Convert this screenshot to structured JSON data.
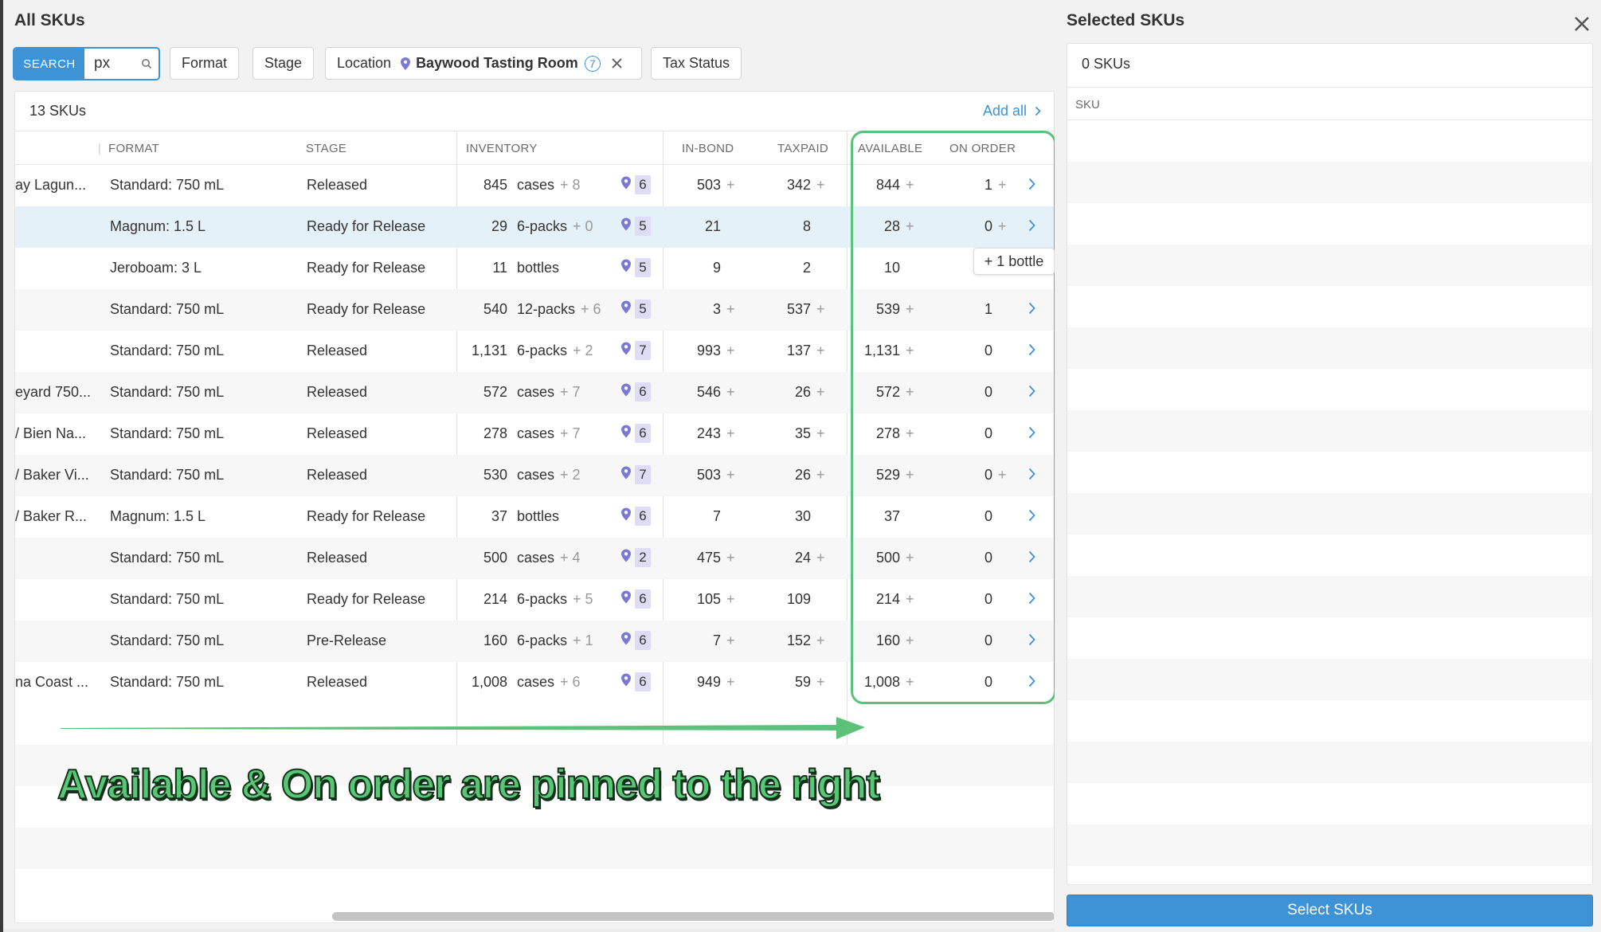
{
  "left_panel": {
    "title": "All SKUs",
    "search": {
      "tag": "SEARCH",
      "value": "px"
    },
    "filters": {
      "format": "Format",
      "stage": "Stage",
      "location_label": "Location",
      "location_value": "Baywood Tasting Room",
      "location_count": "7",
      "tax_status": "Tax Status"
    },
    "count_label": "13 SKUs",
    "add_all": "Add all",
    "columns": {
      "format": "FORMAT",
      "stage": "STAGE",
      "inventory": "INVENTORY",
      "in_bond": "IN-BOND",
      "taxpaid": "TAXPAID",
      "available": "AVAILABLE",
      "on_order": "ON ORDER"
    },
    "rows": [
      {
        "name": "ay Lagun...",
        "format": "Standard: 750 mL",
        "stage": "Released",
        "inv_qty": "845",
        "inv_unit": "cases",
        "inv_extra": "+ 8",
        "loc_count": "6",
        "in_bond": "503",
        "in_bond_plus": "+",
        "taxpaid": "342",
        "taxpaid_plus": "+",
        "available": "844",
        "available_plus": "+",
        "on_order": "1",
        "on_order_plus": "+"
      },
      {
        "name": "",
        "format": "Magnum: 1.5 L",
        "stage": "Ready for Release",
        "inv_qty": "29",
        "inv_unit": "6-packs",
        "inv_extra": "+ 0",
        "loc_count": "5",
        "in_bond": "21",
        "in_bond_plus": "",
        "taxpaid": "8",
        "taxpaid_plus": "",
        "available": "28",
        "available_plus": "+",
        "on_order": "0",
        "on_order_plus": "+"
      },
      {
        "name": "",
        "format": "Jeroboam: 3 L",
        "stage": "Ready for Release",
        "inv_qty": "11",
        "inv_unit": "bottles",
        "inv_extra": "",
        "loc_count": "5",
        "in_bond": "9",
        "in_bond_plus": "",
        "taxpaid": "2",
        "taxpaid_plus": "",
        "available": "10",
        "available_plus": "",
        "on_order": "",
        "on_order_plus": ""
      },
      {
        "name": "",
        "format": "Standard: 750 mL",
        "stage": "Ready for Release",
        "inv_qty": "540",
        "inv_unit": "12-packs",
        "inv_extra": "+ 6",
        "loc_count": "5",
        "in_bond": "3",
        "in_bond_plus": "+",
        "taxpaid": "537",
        "taxpaid_plus": "+",
        "available": "539",
        "available_plus": "+",
        "on_order": "1",
        "on_order_plus": ""
      },
      {
        "name": "",
        "format": "Standard: 750 mL",
        "stage": "Released",
        "inv_qty": "1,131",
        "inv_unit": "6-packs",
        "inv_extra": "+ 2",
        "loc_count": "7",
        "in_bond": "993",
        "in_bond_plus": "+",
        "taxpaid": "137",
        "taxpaid_plus": "+",
        "available": "1,131",
        "available_plus": "+",
        "on_order": "0",
        "on_order_plus": ""
      },
      {
        "name": "eyard 750...",
        "format": "Standard: 750 mL",
        "stage": "Released",
        "inv_qty": "572",
        "inv_unit": "cases",
        "inv_extra": "+ 7",
        "loc_count": "6",
        "in_bond": "546",
        "in_bond_plus": "+",
        "taxpaid": "26",
        "taxpaid_plus": "+",
        "available": "572",
        "available_plus": "+",
        "on_order": "0",
        "on_order_plus": ""
      },
      {
        "name": "/ Bien Na...",
        "format": "Standard: 750 mL",
        "stage": "Released",
        "inv_qty": "278",
        "inv_unit": "cases",
        "inv_extra": "+ 7",
        "loc_count": "6",
        "in_bond": "243",
        "in_bond_plus": "+",
        "taxpaid": "35",
        "taxpaid_plus": "+",
        "available": "278",
        "available_plus": "+",
        "on_order": "0",
        "on_order_plus": ""
      },
      {
        "name": "/ Baker Vi...",
        "format": "Standard: 750 mL",
        "stage": "Released",
        "inv_qty": "530",
        "inv_unit": "cases",
        "inv_extra": "+ 2",
        "loc_count": "7",
        "in_bond": "503",
        "in_bond_plus": "+",
        "taxpaid": "26",
        "taxpaid_plus": "+",
        "available": "529",
        "available_plus": "+",
        "on_order": "0",
        "on_order_plus": "+"
      },
      {
        "name": "/ Baker R...",
        "format": "Magnum: 1.5 L",
        "stage": "Ready for Release",
        "inv_qty": "37",
        "inv_unit": "bottles",
        "inv_extra": "",
        "loc_count": "6",
        "in_bond": "7",
        "in_bond_plus": "",
        "taxpaid": "30",
        "taxpaid_plus": "",
        "available": "37",
        "available_plus": "",
        "on_order": "0",
        "on_order_plus": ""
      },
      {
        "name": "",
        "format": "Standard: 750 mL",
        "stage": "Released",
        "inv_qty": "500",
        "inv_unit": "cases",
        "inv_extra": "+ 4",
        "loc_count": "2",
        "in_bond": "475",
        "in_bond_plus": "+",
        "taxpaid": "24",
        "taxpaid_plus": "+",
        "available": "500",
        "available_plus": "+",
        "on_order": "0",
        "on_order_plus": ""
      },
      {
        "name": "",
        "format": "Standard: 750 mL",
        "stage": "Ready for Release",
        "inv_qty": "214",
        "inv_unit": "6-packs",
        "inv_extra": "+ 5",
        "loc_count": "6",
        "in_bond": "105",
        "in_bond_plus": "+",
        "taxpaid": "109",
        "taxpaid_plus": "",
        "available": "214",
        "available_plus": "+",
        "on_order": "0",
        "on_order_plus": ""
      },
      {
        "name": "",
        "format": "Standard: 750 mL",
        "stage": "Pre-Release",
        "inv_qty": "160",
        "inv_unit": "6-packs",
        "inv_extra": "+ 1",
        "loc_count": "6",
        "in_bond": "7",
        "in_bond_plus": "+",
        "taxpaid": "152",
        "taxpaid_plus": "+",
        "available": "160",
        "available_plus": "+",
        "on_order": "0",
        "on_order_plus": ""
      },
      {
        "name": "na Coast ...",
        "format": "Standard: 750 mL",
        "stage": "Released",
        "inv_qty": "1,008",
        "inv_unit": "cases",
        "inv_extra": "+ 6",
        "loc_count": "6",
        "in_bond": "949",
        "in_bond_plus": "+",
        "taxpaid": "59",
        "taxpaid_plus": "+",
        "available": "1,008",
        "available_plus": "+",
        "on_order": "0",
        "on_order_plus": ""
      }
    ],
    "tooltip": "+ 1 bottle",
    "annotation": "Available & On order are pinned to the right"
  },
  "right_panel": {
    "title": "Selected SKUs",
    "count_label": "0 SKUs",
    "column": "SKU",
    "select_button": "Select SKUs"
  },
  "colors": {
    "accent": "#3e93d6",
    "callout_green": "#5dc17a",
    "location_badge": "#dfdcf5",
    "pin": "#7c78d8",
    "highlight_row": "#e5f1f9"
  },
  "icons": [
    "search-icon",
    "location-pin-icon",
    "clear-filter-icon",
    "chevron-right-icon",
    "close-icon",
    "arrow-right-icon"
  ]
}
